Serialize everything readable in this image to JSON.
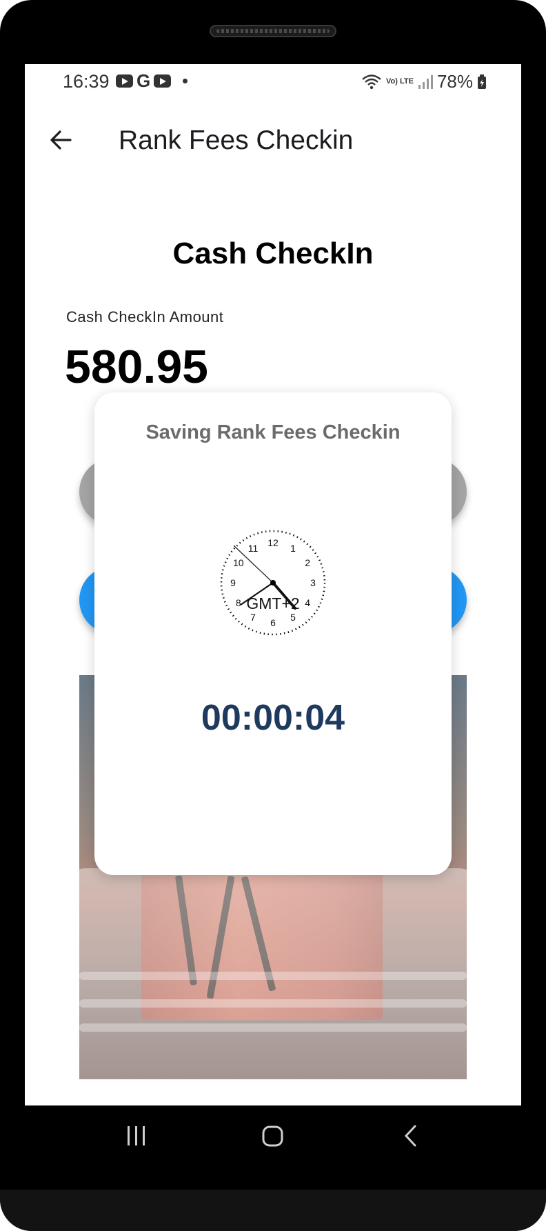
{
  "status_bar": {
    "time": "16:39",
    "battery": "78%",
    "network_label": "Vo) LTE",
    "icons": [
      "youtube-icon",
      "google-icon",
      "youtube-icon",
      "dot-icon",
      "wifi-icon",
      "volte-icon",
      "signal-icon",
      "battery-icon"
    ]
  },
  "app_bar": {
    "title": "Rank Fees Checkin",
    "back_icon": "arrow-left-icon"
  },
  "page": {
    "heading": "Cash CheckIn",
    "amount_label": "Cash CheckIn Amount",
    "amount_value": "580.95"
  },
  "dialog": {
    "title": "Saving Rank Fees Checkin",
    "clock_timezone": "GMT+2",
    "clock_numbers": [
      "12",
      "1",
      "2",
      "3",
      "4",
      "5",
      "6",
      "7",
      "8",
      "9",
      "10",
      "11"
    ],
    "timer": "00:00:04"
  },
  "colors": {
    "primary_blue": "#2196f3",
    "disabled_grey": "#a4a4a4",
    "timer_text": "#1f3a5f",
    "dialog_title": "#6b6b6b"
  },
  "nav_bar": {
    "icons": [
      "recents-icon",
      "home-icon",
      "back-icon"
    ]
  }
}
